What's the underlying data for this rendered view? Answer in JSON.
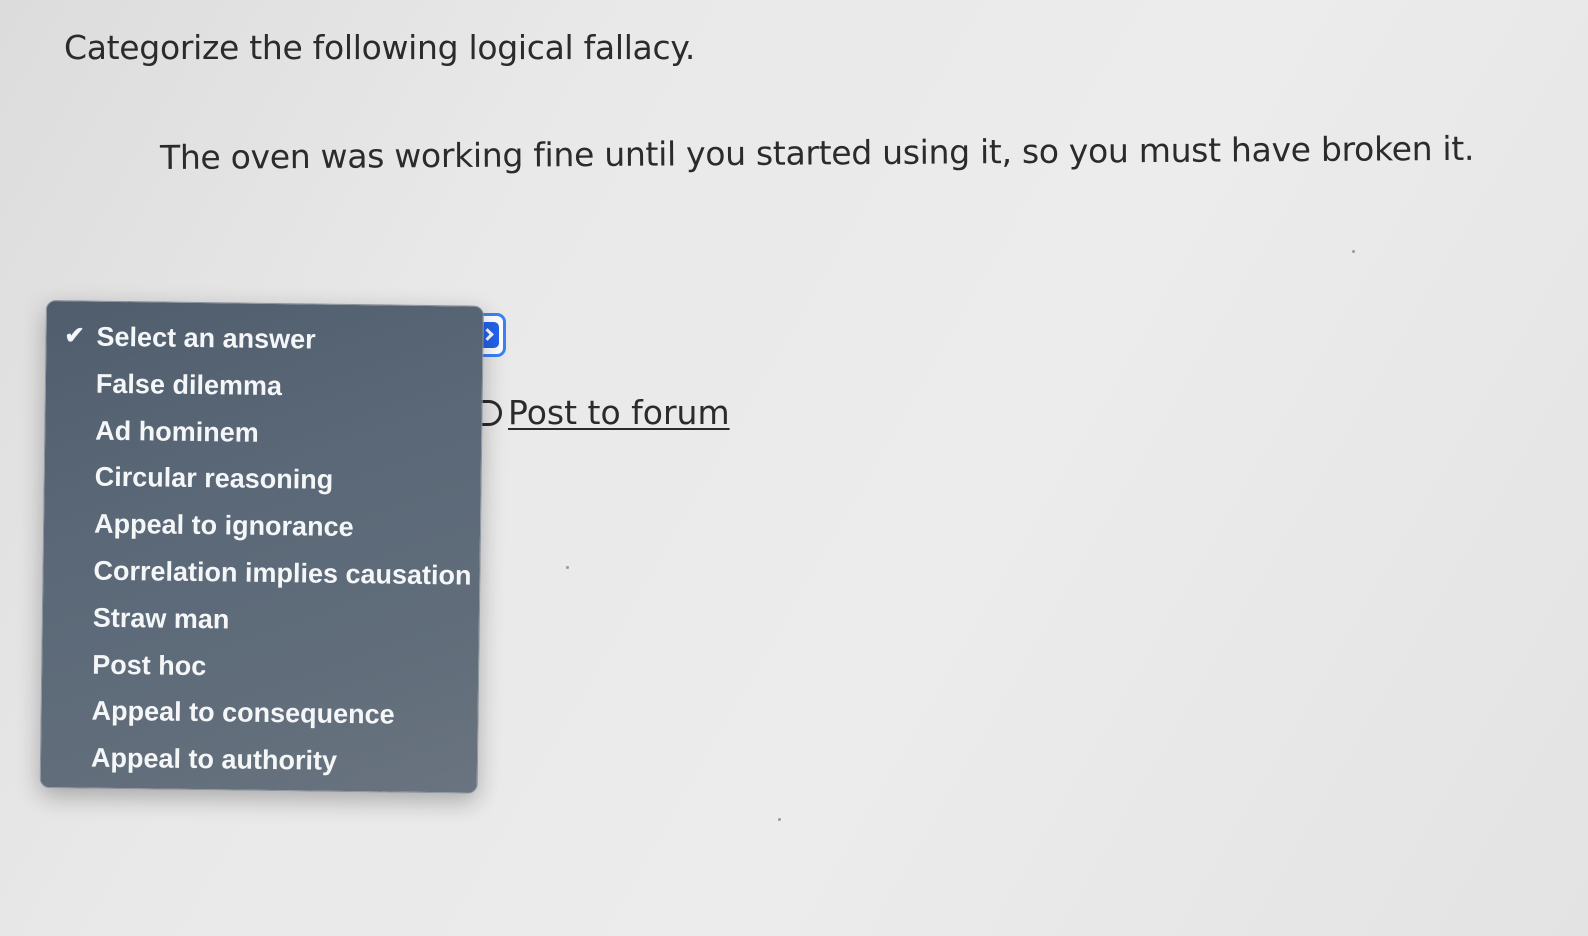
{
  "question": {
    "prompt": "Categorize the following logical fallacy.",
    "statement": "The oven was working fine until you started using it, so you must have broken it."
  },
  "dropdown": {
    "selected_index": 0,
    "options": [
      "Select an answer",
      "False dilemma",
      "Ad hominem",
      "Circular reasoning",
      "Appeal to ignorance",
      "Correlation implies causation",
      "Straw man",
      "Post hoc",
      "Appeal to consequence",
      "Appeal to authority"
    ]
  },
  "forum": {
    "label": "Post to forum"
  },
  "icons": {
    "check": "checkmark-icon",
    "select_arrow": "chevron-updown-icon",
    "forum": "comment-icon"
  },
  "colors": {
    "focus_ring": "#3b82f6",
    "menu_background": "#5a6878",
    "menu_text": "#f4f6f8"
  }
}
